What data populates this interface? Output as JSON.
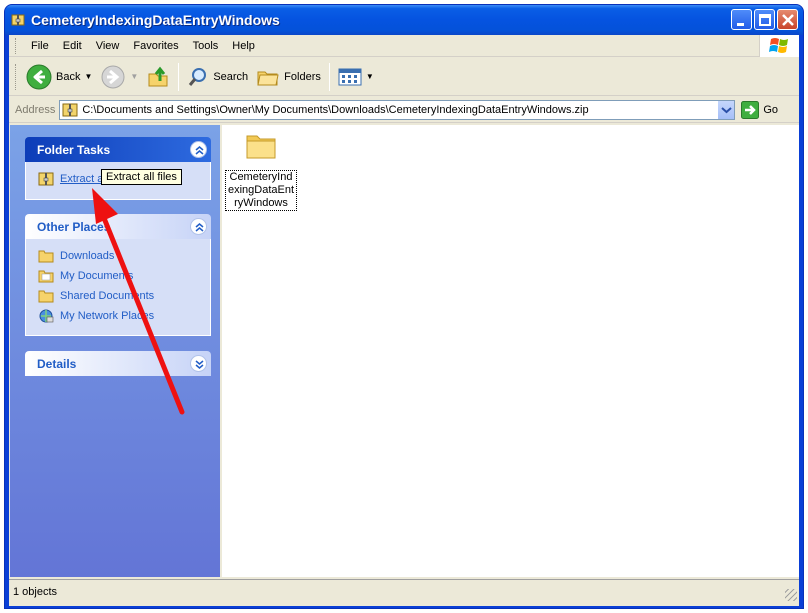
{
  "window": {
    "title": "CemeteryIndexingDataEntryWindows"
  },
  "menu": {
    "items": [
      "File",
      "Edit",
      "View",
      "Favorites",
      "Tools",
      "Help"
    ]
  },
  "toolbar": {
    "back": "Back",
    "search": "Search",
    "folders": "Folders"
  },
  "address": {
    "label": "Address",
    "value": "C:\\Documents and Settings\\Owner\\My Documents\\Downloads\\CemeteryIndexingDataEntryWindows.zip",
    "go": "Go"
  },
  "folder_tasks": {
    "title": "Folder Tasks",
    "items": [
      {
        "label": "Extract all files"
      }
    ]
  },
  "tooltip": {
    "text": "Extract all files"
  },
  "other_places": {
    "title": "Other Places",
    "items": [
      {
        "label": "Downloads",
        "icon": "folder-icon"
      },
      {
        "label": "My Documents",
        "icon": "folder-icon"
      },
      {
        "label": "Shared Documents",
        "icon": "folder-icon"
      },
      {
        "label": "My Network Places",
        "icon": "network-icon"
      }
    ]
  },
  "details": {
    "title": "Details"
  },
  "files": [
    {
      "name": "CemeteryIndexingDataEntryWindows",
      "icon": "folder-icon"
    }
  ],
  "status": {
    "text": "1 objects"
  },
  "colors": {
    "titlebar": "#0553e0",
    "taskpane": "#6d8fe0",
    "link": "#215dc6",
    "annotation_arrow": "#ee1111"
  }
}
